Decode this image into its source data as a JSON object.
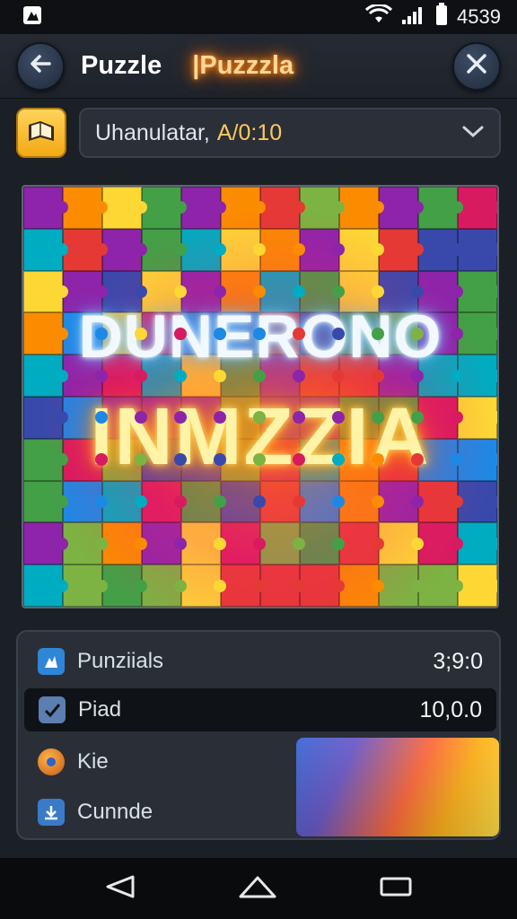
{
  "status_bar": {
    "time": "4539",
    "icons": [
      "wifi-icon",
      "signal-icon",
      "battery-icon"
    ]
  },
  "app_bar": {
    "title": "Puzzle",
    "subtitle": "|Puzzzla",
    "back_icon": "back-arrow-icon",
    "close_icon": "close-icon"
  },
  "filter": {
    "icon": "book-icon",
    "label": "Uhanulatar,",
    "value": "A/0:10",
    "chevron": "chevron-down-icon"
  },
  "board": {
    "line1": "DUNERONO",
    "line2": "INMZZIA",
    "colors": [
      "#e53935",
      "#fdd835",
      "#43a047",
      "#1e88e5",
      "#8e24aa",
      "#fb8c00",
      "#00acc1",
      "#d81b60",
      "#7cb342",
      "#3949ab"
    ]
  },
  "stats": {
    "rows": [
      {
        "label": "Punziials",
        "value": "3;9:0",
        "icon": "puzzle-icon"
      },
      {
        "label": "Ρiad",
        "value": "10,0.0",
        "icon": "checkbox-icon"
      },
      {
        "label": "Kie",
        "icon": "coin-icon"
      },
      {
        "label": "Cunnde",
        "icon": "download-icon"
      }
    ]
  },
  "nav": {
    "back": "nav-back-icon",
    "home": "nav-home-icon",
    "recents": "nav-recents-icon"
  },
  "colors": {
    "accent_orange": "#ff7a00",
    "accent_yellow": "#f2a914",
    "panel": "#2a2f37",
    "background": "#1b1f26"
  }
}
